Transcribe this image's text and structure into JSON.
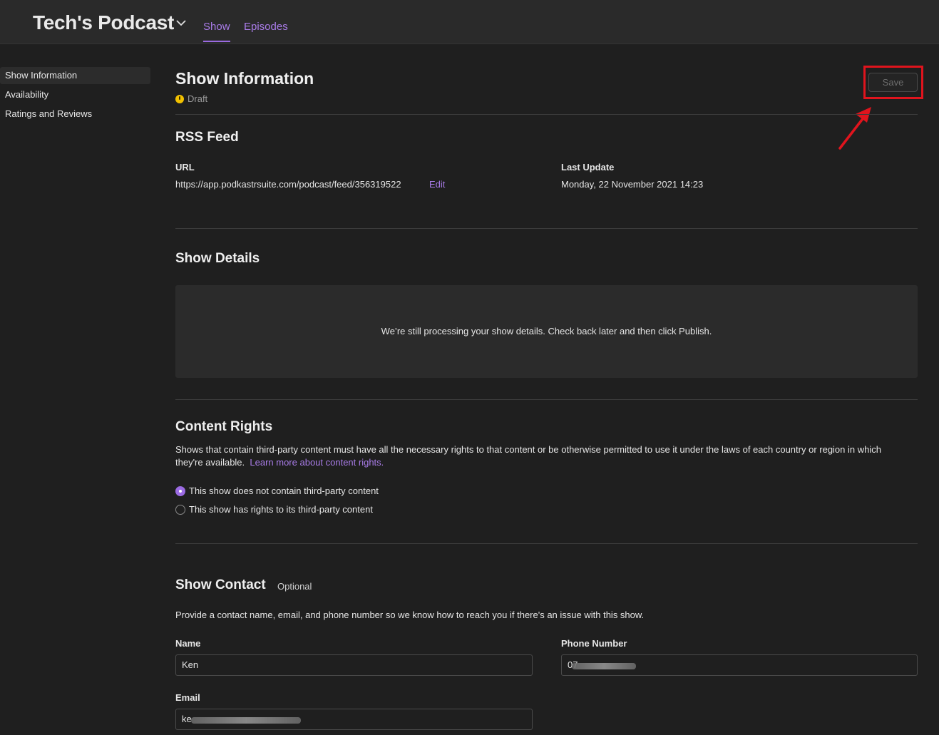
{
  "header": {
    "title": "Tech's Podcast",
    "tabs": [
      {
        "label": "Show",
        "active": true
      },
      {
        "label": "Episodes",
        "active": false
      }
    ]
  },
  "sidebar": {
    "items": [
      {
        "label": "Show Information",
        "active": true
      },
      {
        "label": "Availability",
        "active": false
      },
      {
        "label": "Ratings and Reviews",
        "active": false
      }
    ]
  },
  "main": {
    "title": "Show Information",
    "status": "Draft",
    "save_label": "Save",
    "rss": {
      "heading": "RSS Feed",
      "url_label": "URL",
      "url_value": "https://app.podkastrsuite.com/podcast/feed/356319522",
      "edit_label": "Edit",
      "last_update_label": "Last Update",
      "last_update_value": "Monday, 22 November 2021 14:23"
    },
    "details": {
      "heading": "Show Details",
      "processing_message": "We’re still processing your show details. Check back later and then click Publish."
    },
    "rights": {
      "heading": "Content Rights",
      "description": "Shows that contain third-party content must have all the necessary rights to that content or be otherwise permitted to use it under the laws of each country or region in which they're available.",
      "learn_more": "Learn more about content rights.",
      "options": [
        {
          "label": "This show does not contain third-party content",
          "selected": true
        },
        {
          "label": "This show has rights to its third-party content",
          "selected": false
        }
      ]
    },
    "contact": {
      "heading": "Show Contact",
      "optional": "Optional",
      "description": "Provide a contact name, email, and phone number so we know how to reach you if there's an issue with this show.",
      "name_label": "Name",
      "name_value": "Ken",
      "phone_label": "Phone Number",
      "phone_value": "07",
      "email_label": "Email",
      "email_value": "ke"
    }
  },
  "colors": {
    "accent": "#a97ce8",
    "status_draft": "#f2c100",
    "highlight": "#e0141d"
  }
}
